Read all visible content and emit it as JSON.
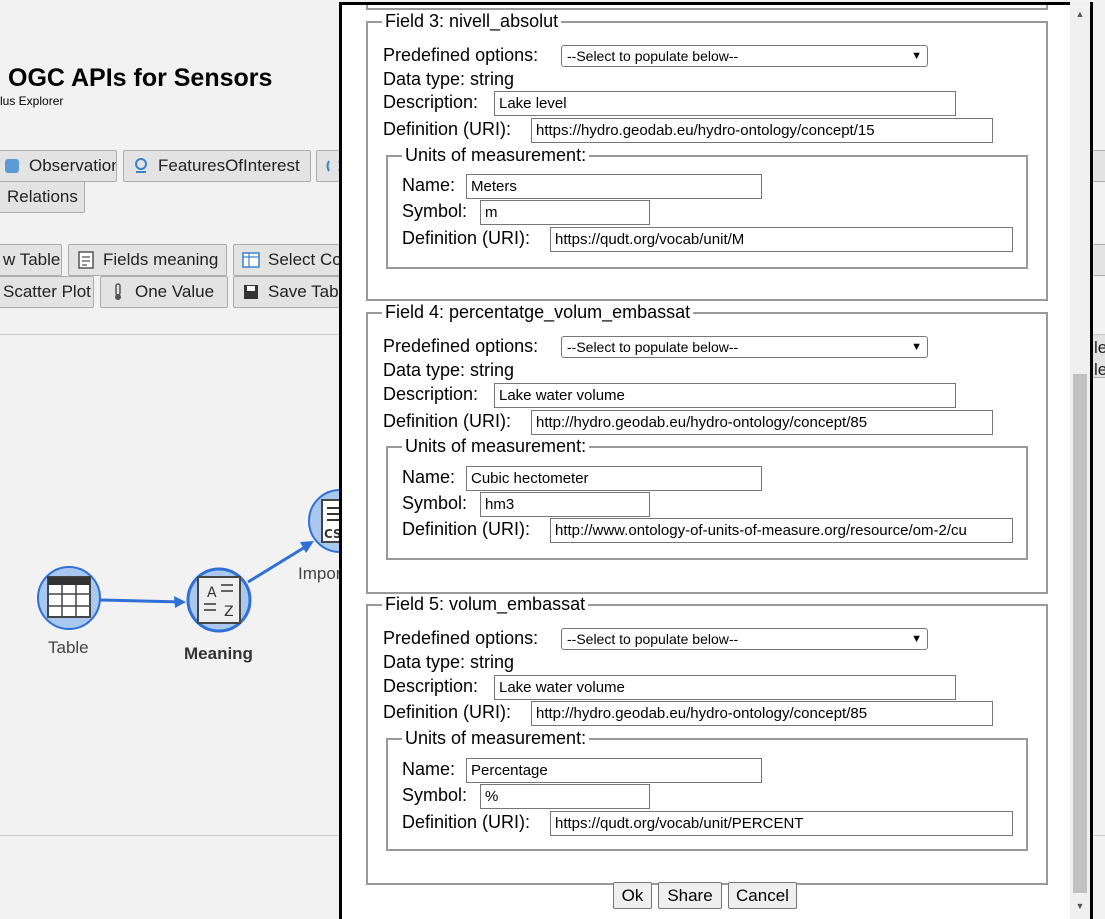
{
  "app": {
    "title": "OGC APIs for Sensors",
    "subtitle": "lus Explorer"
  },
  "toolbar": {
    "row1": [
      "Observations",
      "FeaturesOfInterest"
    ],
    "row2": [
      "Relations"
    ],
    "row3": [
      "w Table",
      "Fields meaning",
      "Select Co"
    ],
    "row4": [
      "Scatter Plot",
      "One Value",
      "Save Tab"
    ]
  },
  "graph": {
    "nodes": [
      "Table",
      "Meaning",
      "Impor"
    ]
  },
  "dialog": {
    "fields": [
      {
        "legend": "Field 3: nivell_absolut",
        "predefined_label": "Predefined options:",
        "predefined_value": "--Select to populate below--",
        "data_type": "Data type: string",
        "description_label": "Description:",
        "description_value": "Lake level",
        "definition_label": "Definition (URI):",
        "definition_value": "https://hydro.geodab.eu/hydro-ontology/concept/15",
        "units": {
          "legend": "Units of measurement:",
          "name_label": "Name:",
          "name_value": "Meters",
          "symbol_label": "Symbol:",
          "symbol_value": "m",
          "definition_label": "Definition (URI):",
          "definition_value": "https://qudt.org/vocab/unit/M"
        }
      },
      {
        "legend": "Field 4: percentatge_volum_embassat",
        "predefined_label": "Predefined options:",
        "predefined_value": "--Select to populate below--",
        "data_type": "Data type: string",
        "description_label": "Description:",
        "description_value": "Lake water volume",
        "definition_label": "Definition (URI):",
        "definition_value": "http://hydro.geodab.eu/hydro-ontology/concept/85",
        "units": {
          "legend": "Units of measurement:",
          "name_label": "Name:",
          "name_value": "Cubic hectometer",
          "symbol_label": "Symbol:",
          "symbol_value": "hm3",
          "definition_label": "Definition (URI):",
          "definition_value": "http://www.ontology-of-units-of-measure.org/resource/om-2/cu"
        }
      },
      {
        "legend": "Field 5: volum_embassat",
        "predefined_label": "Predefined options:",
        "predefined_value": "--Select to populate below--",
        "data_type": "Data type: string",
        "description_label": "Description:",
        "description_value": "Lake water volume",
        "definition_label": "Definition (URI):",
        "definition_value": "http://hydro.geodab.eu/hydro-ontology/concept/85",
        "units": {
          "legend": "Units of measurement:",
          "name_label": "Name:",
          "name_value": "Percentage",
          "symbol_label": "Symbol:",
          "symbol_value": "%",
          "definition_label": "Definition (URI):",
          "definition_value": "https://qudt.org/vocab/unit/PERCENT"
        }
      }
    ],
    "buttons": {
      "ok": "Ok",
      "share": "Share",
      "cancel": "Cancel"
    }
  },
  "colors": {
    "accent": "#2f6fd6",
    "node_fill": "#a9c8f0"
  }
}
